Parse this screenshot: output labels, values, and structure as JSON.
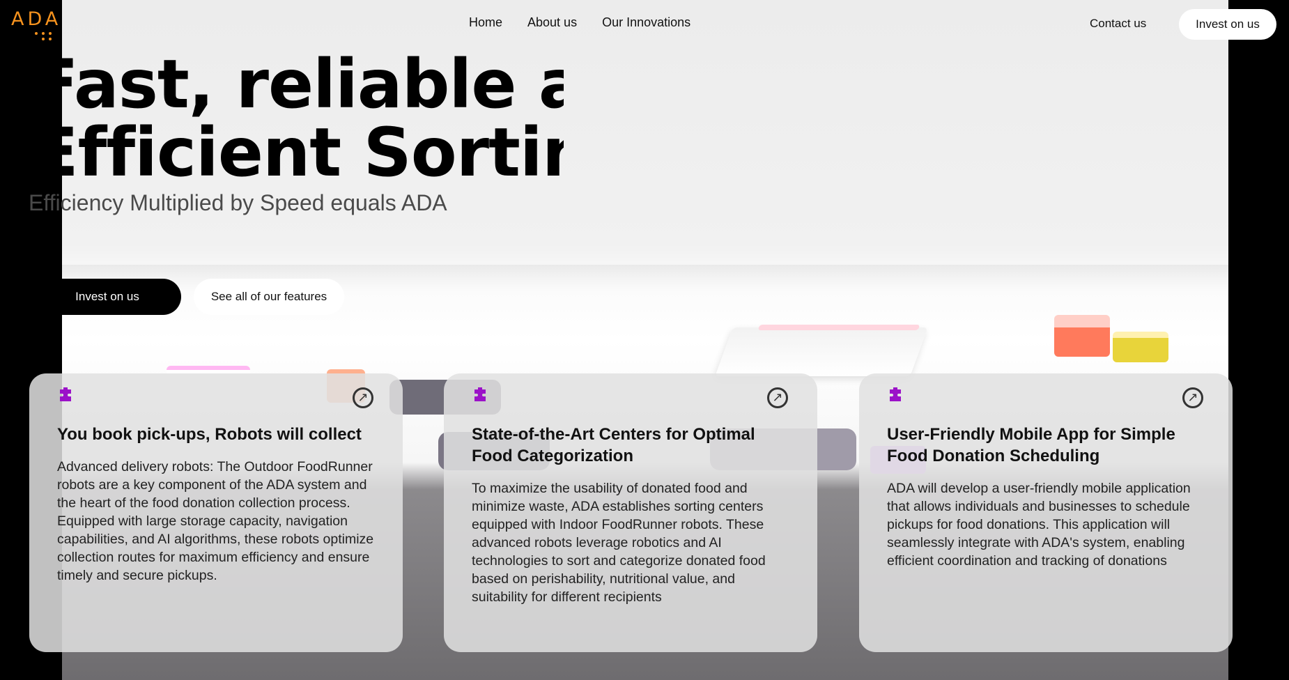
{
  "brand": {
    "logo_text": "ADA",
    "accent": "#f7931e"
  },
  "nav": {
    "items": [
      "Home",
      "About us",
      "Our Innovations"
    ],
    "contact": "Contact us",
    "invest": "Invest on us"
  },
  "hero": {
    "headline_line1": "Fast, reliable and",
    "headline_line2": "Efficient Sorting",
    "subheadline": "Efficiency Multiplied by Speed equals ADA",
    "primary_button": "Invest on us",
    "secondary_button": "See all of our features"
  },
  "cards": [
    {
      "icon": "puzzle-icon",
      "title": "You book pick-ups, Robots will collect",
      "body": "Advanced delivery robots: The Outdoor FoodRunner robots are a key component of the ADA system and the heart of the food donation collection process. Equipped with large storage capacity, navigation capabilities, and AI algorithms, these robots optimize collection routes for maximum efficiency and ensure timely and secure pickups."
    },
    {
      "icon": "puzzle-icon",
      "title": "State-of-the-Art Centers for Optimal Food Categorization",
      "body": "To maximize the usability of donated food and minimize waste, ADA establishes sorting centers equipped with Indoor FoodRunner robots. These advanced robots leverage robotics and AI technologies to sort and categorize donated food based on perishability, nutritional value, and suitability for different recipients"
    },
    {
      "icon": "puzzle-icon",
      "title": "User-Friendly Mobile App for Simple Food Donation Scheduling",
      "body": "ADA will develop a user-friendly mobile application that allows individuals and businesses to schedule pickups for food donations. This application will seamlessly integrate with ADA's system, enabling efficient coordination and tracking of donations"
    }
  ],
  "colors": {
    "puzzle": "#9b12c8",
    "card_bg": "#e1e1e1"
  }
}
